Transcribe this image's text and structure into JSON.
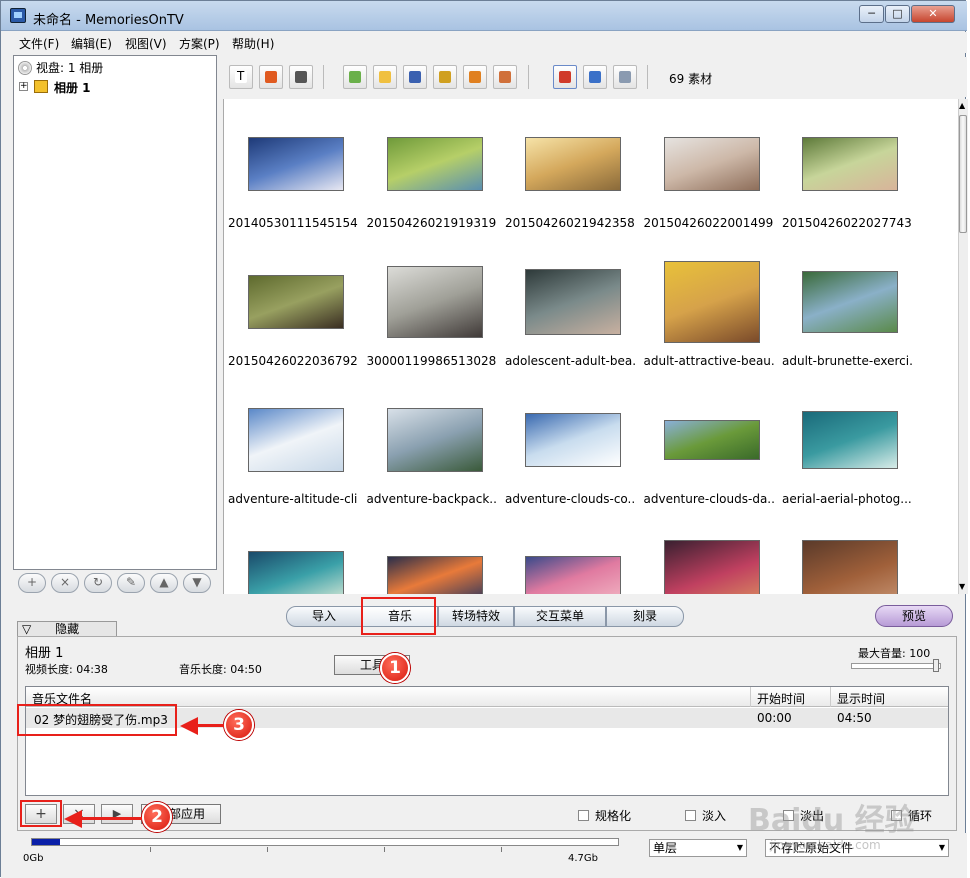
{
  "window": {
    "title": "未命名 - MemoriesOnTV",
    "min": "─",
    "max": "□",
    "close": "✕"
  },
  "menu": [
    "文件(F)",
    "编辑(E)",
    "视图(V)",
    "方案(P)",
    "帮助(H)"
  ],
  "tree": {
    "disc": "视盘: 1 相册",
    "expander": "+",
    "album": "相册 1"
  },
  "tree_buttons": [
    "+",
    "×",
    "↻",
    "✎",
    "▲",
    "▼"
  ],
  "toolbar": {
    "count": "69 素材"
  },
  "thumbnails": [
    {
      "caption": "20140530111545154...",
      "colors": [
        "#1e3a78",
        "#5a7fc4",
        "#e8e8f2"
      ],
      "h": 54
    },
    {
      "caption": "20150426021919319...",
      "colors": [
        "#6f9a3a",
        "#b6cf68",
        "#5a8fb0"
      ],
      "h": 54
    },
    {
      "caption": "20150426021942358...",
      "colors": [
        "#f6e3a8",
        "#d4a85c",
        "#8a6a3a"
      ],
      "h": 54
    },
    {
      "caption": "20150426022001499...",
      "colors": [
        "#e6e3e0",
        "#cdb8a8",
        "#8e6e5a"
      ],
      "h": 54
    },
    {
      "caption": "20150426022027743...",
      "colors": [
        "#5e7a3a",
        "#c7d59a",
        "#d8b49a"
      ],
      "h": 54
    },
    {
      "caption": "20150426022036792...",
      "colors": [
        "#5e6a2e",
        "#98a060",
        "#3a2e22"
      ],
      "h": 54
    },
    {
      "caption": "30000119986513028...",
      "colors": [
        "#dcdcd8",
        "#a0a098",
        "#403a38"
      ],
      "h": 72
    },
    {
      "caption": "adolescent-adult-bea...",
      "colors": [
        "#2e3a3a",
        "#7a8a8a",
        "#c8b0a0"
      ],
      "h": 66
    },
    {
      "caption": "adult-attractive-beau...",
      "colors": [
        "#e8c13a",
        "#d6a24a",
        "#7a4a2a"
      ],
      "h": 82
    },
    {
      "caption": "adult-brunette-exerci...",
      "colors": [
        "#3a6a3a",
        "#8ab0c8",
        "#5a8a4a"
      ],
      "h": 62
    },
    {
      "caption": "adventure-altitude-cli...",
      "colors": [
        "#5a88c8",
        "#f0f4f8",
        "#c8d8e8"
      ],
      "h": 64
    },
    {
      "caption": "adventure-backpack...",
      "colors": [
        "#d8e0e8",
        "#8aa0b0",
        "#3a5a3a"
      ],
      "h": 64
    },
    {
      "caption": "adventure-clouds-co...",
      "colors": [
        "#3a6ab0",
        "#c8dcee",
        "#ffffff"
      ],
      "h": 54
    },
    {
      "caption": "adventure-clouds-da...",
      "colors": [
        "#8ab0d8",
        "#6a9a3a",
        "#3a6a2a"
      ],
      "h": 40
    },
    {
      "caption": "aerial-aerial-photog...",
      "colors": [
        "#1a6a7a",
        "#3a9aa0",
        "#d8ece8"
      ],
      "h": 58
    },
    {
      "caption": "",
      "colors": [
        "#1a4a6a",
        "#3aa0a8",
        "#e0ecd8"
      ],
      "h": 54
    },
    {
      "caption": "",
      "colors": [
        "#2a2e4a",
        "#e87a3a",
        "#3a3a5a"
      ],
      "h": 44
    },
    {
      "caption": "",
      "colors": [
        "#3a4a8a",
        "#e07aa0",
        "#f0b0c0"
      ],
      "h": 44
    },
    {
      "caption": "",
      "colors": [
        "#3a2030",
        "#c04060",
        "#e0a060"
      ],
      "h": 76
    },
    {
      "caption": "",
      "colors": [
        "#5a3a2a",
        "#a0603a",
        "#d0a080"
      ],
      "h": 76
    }
  ],
  "tabs": [
    "导入",
    "音乐",
    "转场特效",
    "交互菜单",
    "刻录"
  ],
  "preview_label": "预览",
  "panel": {
    "hide_tab": "隐藏",
    "hide_arrow": "▽",
    "album": "相册 1",
    "video_length": "视频长度: 04:38",
    "music_length": "音乐长度: 04:50",
    "tool_button": "工具",
    "max_volume": "最大音量: 100",
    "columns": [
      "音乐文件名",
      "开始时间",
      "显示时间"
    ],
    "rows": [
      {
        "name": "02 梦的翅膀受了伤.mp3",
        "start": "00:00",
        "display": "04:50"
      }
    ],
    "buttons": {
      "add": "+",
      "remove": "×",
      "play": "▶",
      "apply_all": "全部应用"
    },
    "checkboxes": [
      "规格化",
      "淡入",
      "淡出",
      "循环"
    ]
  },
  "status": {
    "cap_start": "0Gb",
    "cap_end": "4.7Gb",
    "capacity_fraction": 0.048,
    "layer": "单层",
    "option": "不存贮原始文件"
  },
  "callouts": [
    "1",
    "2",
    "3"
  ],
  "watermark": "Baidu 经验",
  "watermark_sub": "jingyan.baidu.com"
}
